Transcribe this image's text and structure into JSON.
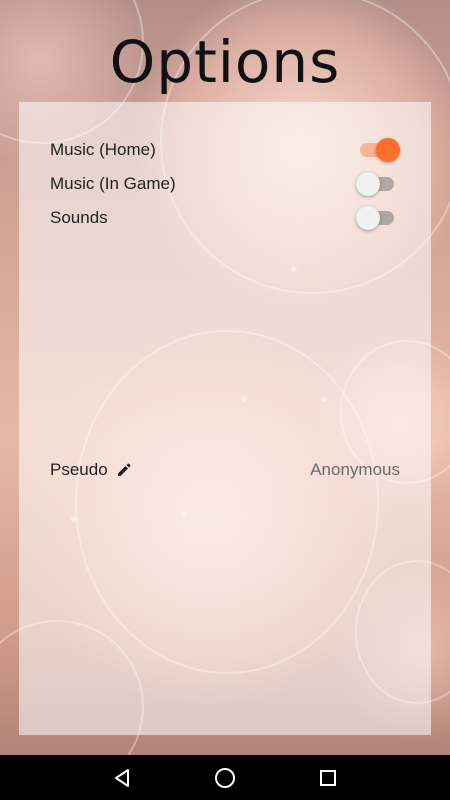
{
  "header": {
    "title": "Options"
  },
  "settings": {
    "items": [
      {
        "label": "Music (Home)",
        "enabled": true
      },
      {
        "label": "Music (In Game)",
        "enabled": false
      },
      {
        "label": "Sounds",
        "enabled": false
      }
    ]
  },
  "pseudo": {
    "label": "Pseudo",
    "value": "Anonymous",
    "edit_icon": "pencil-icon"
  },
  "navbar": {
    "back_icon": "back-triangle-icon",
    "home_icon": "home-circle-icon",
    "recents_icon": "recents-square-icon"
  },
  "colors": {
    "accent": "#fb6f2c"
  }
}
